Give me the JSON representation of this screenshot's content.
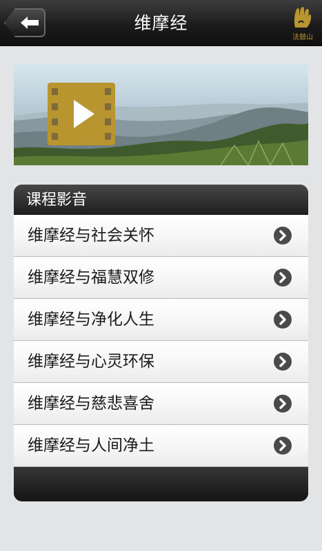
{
  "header": {
    "title": "维摩经",
    "back_icon": "back-arrow-icon",
    "logo_text": "法鼓山"
  },
  "banner": {
    "icon": "video-play-icon",
    "accent": "#b8952f"
  },
  "course": {
    "header": "课程影音",
    "items": [
      {
        "label": "维摩经与社会关怀"
      },
      {
        "label": "维摩经与福慧双修"
      },
      {
        "label": "维摩经与净化人生"
      },
      {
        "label": "维摩经与心灵环保"
      },
      {
        "label": "维摩经与慈悲喜舍"
      },
      {
        "label": "维摩经与人间净土"
      }
    ],
    "item_icon": "chevron-right-icon"
  }
}
